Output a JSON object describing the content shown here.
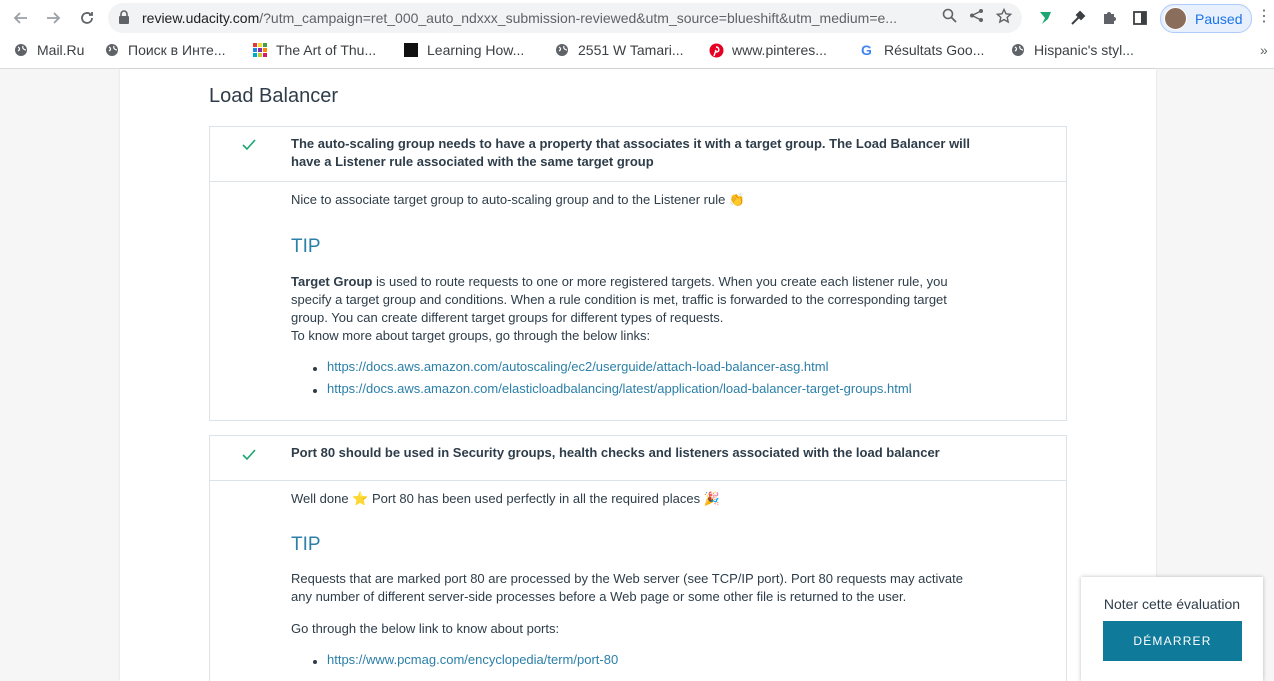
{
  "browser": {
    "url_host": "review.udacity.com",
    "url_rest": "/?utm_campaign=ret_000_auto_ndxxx_submission-reviewed&utm_source=blueshift&utm_medium=e...",
    "profile_label": "Paused"
  },
  "bookmarks": [
    {
      "label": "Mail.Ru",
      "icon": "globe-icon"
    },
    {
      "label": "Поиск в Инте...",
      "icon": "globe-icon"
    },
    {
      "label": "The Art of Thu...",
      "icon": "grid-icon"
    },
    {
      "label": "Learning How...",
      "icon": "cbt-icon"
    },
    {
      "label": "2551 W Tamari...",
      "icon": "globe-icon"
    },
    {
      "label": "www.pinteres...",
      "icon": "pinterest-icon"
    },
    {
      "label": "Résultats Goo...",
      "icon": "google-icon"
    },
    {
      "label": "Hispanic's styl...",
      "icon": "globe-icon"
    }
  ],
  "section": {
    "title": "Load Balancer"
  },
  "rubric": [
    {
      "criterion": "The auto-scaling group needs to have a property that associates it with a target group. The Load Balancer will have a Listener rule associated with the same target group",
      "comment": "Nice to associate target group to auto-scaling group and to the Listener rule 👏",
      "tip_heading": "TIP",
      "tip_bold": "Target Group",
      "tip_text": " is used to route requests to one or more registered targets. When you create each listener rule, you specify a target group and conditions. When a rule condition is met, traffic is forwarded to the corresponding target group. You can create different target groups for different types of requests.",
      "tip_more": "To know more about target groups, go through the below links:",
      "links": [
        "https://docs.aws.amazon.com/autoscaling/ec2/userguide/attach-load-balancer-asg.html",
        "https://docs.aws.amazon.com/elasticloadbalancing/latest/application/load-balancer-target-groups.html"
      ]
    },
    {
      "criterion": "Port 80 should be used in Security groups, health checks and listeners associated with the load balancer",
      "comment": "Well done ⭐ Port 80 has been used perfectly in all the required places 🎉",
      "tip_heading": "TIP",
      "tip_text": "Requests that are marked port 80 are processed by the Web server (see TCP/IP port). Port 80 requests may activate any number of different server-side processes before a Web page or some other file is returned to the user.",
      "tip_more": "Go through the below link to know about ports:",
      "links": [
        "https://www.pcmag.com/encyclopedia/term/port-80"
      ]
    }
  ],
  "rating": {
    "title": "Noter cette évaluation",
    "button": "DÉMARRER"
  },
  "colors": {
    "accent": "#0f7a99",
    "link": "#2b7fa8",
    "check": "#02b3e4"
  }
}
